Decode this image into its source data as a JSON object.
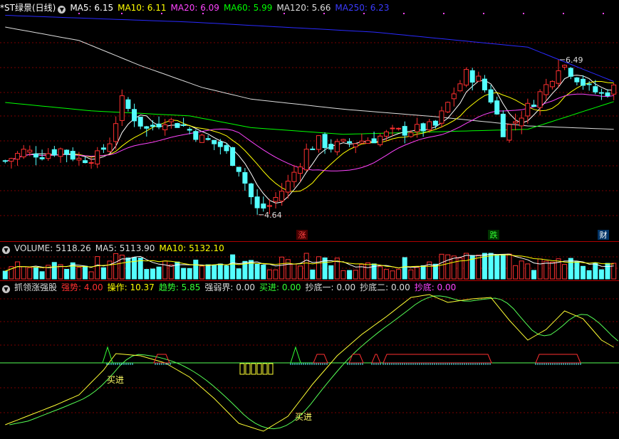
{
  "colors": {
    "bg": "#000000",
    "up": "#ff3030",
    "down": "#54ffff",
    "ma5": "#ffffff",
    "ma10": "#ffff00",
    "ma20": "#ff44ff",
    "ma60": "#00ff00",
    "ma120": "#dddddd",
    "ma250": "#2a2aff",
    "grid": "#7a0000",
    "k": "#ffff33",
    "d": "#55ff55",
    "orange": "#ff9900"
  },
  "price_panel": {
    "title": "*ST绿景(日线)",
    "legend": [
      {
        "key": "MA5",
        "text": "MA5: 6.15",
        "color": "#ffffff"
      },
      {
        "key": "MA10",
        "text": "MA10: 6.11",
        "color": "#ffff00"
      },
      {
        "key": "MA20",
        "text": "MA20: 6.09",
        "color": "#ff44ff"
      },
      {
        "key": "MA60",
        "text": "MA60: 5.99",
        "color": "#00ff00"
      },
      {
        "key": "MA120",
        "text": "MA120: 5.66",
        "color": "#dddddd"
      },
      {
        "key": "MA250",
        "text": "MA250: 6.23",
        "color": "#3b3bff"
      }
    ],
    "high_label": "6.49",
    "low_label": "4.64",
    "markers": [
      {
        "text": "涨",
        "color": "#ff4444",
        "bg": "#4a0000"
      },
      {
        "text": "跌",
        "color": "#33ff33",
        "bg": "#003300"
      },
      {
        "text": "财",
        "color": "#ffffff",
        "bg": "#003366"
      }
    ]
  },
  "volume_panel": {
    "legend": [
      {
        "text": "VOLUME: 5118.26",
        "color": "#dddddd"
      },
      {
        "text": "MA5: 5113.90",
        "color": "#dddddd"
      },
      {
        "text": "MA10: 5132.10",
        "color": "#ffff00"
      }
    ]
  },
  "indicator_panel": {
    "title": "抓领涨强股",
    "legend": [
      {
        "text": "强势: 4.00",
        "color": "#ff3030"
      },
      {
        "text": "操作: 10.37",
        "color": "#ffff00"
      },
      {
        "text": "趋势: 5.85",
        "color": "#33ff33"
      },
      {
        "text": "强弱界: 0.00",
        "color": "#dddddd"
      },
      {
        "text": "买进: 0.00",
        "color": "#33ff33"
      },
      {
        "text": "抄底一: 0.00",
        "color": "#dddddd"
      },
      {
        "text": "抄底二: 0.00",
        "color": "#dddddd"
      },
      {
        "text": "抄底: 0.00",
        "color": "#ff44ff"
      }
    ],
    "buy_labels": [
      "买进",
      "买进"
    ]
  },
  "chart_data": {
    "type": "candlestick",
    "title": "*ST绿景(日线)",
    "n_bars": 100,
    "price_range": [
      4.35,
      7.05
    ],
    "close_anchors": [
      [
        0,
        5.28
      ],
      [
        3,
        5.4
      ],
      [
        6,
        5.36
      ],
      [
        9,
        5.42
      ],
      [
        12,
        5.3
      ],
      [
        15,
        5.34
      ],
      [
        17,
        5.52
      ],
      [
        19,
        6.0
      ],
      [
        21,
        5.8
      ],
      [
        23,
        5.66
      ],
      [
        26,
        5.78
      ],
      [
        29,
        5.7
      ],
      [
        32,
        5.55
      ],
      [
        35,
        5.46
      ],
      [
        38,
        5.2
      ],
      [
        40,
        4.85
      ],
      [
        41,
        4.7
      ],
      [
        43,
        4.75
      ],
      [
        46,
        5.02
      ],
      [
        49,
        5.4
      ],
      [
        51,
        5.52
      ],
      [
        53,
        5.45
      ],
      [
        56,
        5.5
      ],
      [
        60,
        5.55
      ],
      [
        63,
        5.62
      ],
      [
        67,
        5.66
      ],
      [
        70,
        5.7
      ],
      [
        73,
        6.1
      ],
      [
        75,
        6.32
      ],
      [
        77,
        6.25
      ],
      [
        79,
        6.02
      ],
      [
        81,
        5.64
      ],
      [
        83,
        5.76
      ],
      [
        86,
        6.0
      ],
      [
        88,
        6.18
      ],
      [
        89,
        6.3
      ],
      [
        90,
        6.42
      ],
      [
        91,
        6.42
      ],
      [
        93,
        6.28
      ],
      [
        95,
        6.14
      ],
      [
        97,
        6.08
      ],
      [
        99,
        6.15
      ]
    ],
    "ma": [
      {
        "name": "MA5",
        "period": 5,
        "color": "#ffffff"
      },
      {
        "name": "MA10",
        "period": 10,
        "color": "#ffff00"
      },
      {
        "name": "MA20",
        "period": 20,
        "color": "#ff44ff"
      }
    ],
    "ma60_line": [
      [
        0,
        5.98
      ],
      [
        14,
        5.88
      ],
      [
        30,
        5.82
      ],
      [
        40,
        5.68
      ],
      [
        55,
        5.6
      ],
      [
        70,
        5.63
      ],
      [
        85,
        5.66
      ],
      [
        99,
        5.99
      ]
    ],
    "ma120_line": [
      [
        0,
        6.88
      ],
      [
        12,
        6.72
      ],
      [
        22,
        6.42
      ],
      [
        32,
        6.16
      ],
      [
        40,
        6.02
      ],
      [
        55,
        5.9
      ],
      [
        70,
        5.81
      ],
      [
        85,
        5.7
      ],
      [
        99,
        5.66
      ]
    ],
    "ma250_line": [
      [
        0,
        7.02
      ],
      [
        30,
        6.94
      ],
      [
        60,
        6.82
      ],
      [
        85,
        6.64
      ],
      [
        99,
        6.23
      ]
    ],
    "high_point": {
      "bar": 90,
      "value": 6.49
    },
    "low_point": {
      "bar": 41,
      "value": 4.64
    },
    "volume": [
      {
        "name": "VOLUME",
        "value": 5118.26
      },
      {
        "name": "MA5",
        "value": 5113.9
      },
      {
        "name": "MA10",
        "value": 5132.1
      }
    ]
  }
}
